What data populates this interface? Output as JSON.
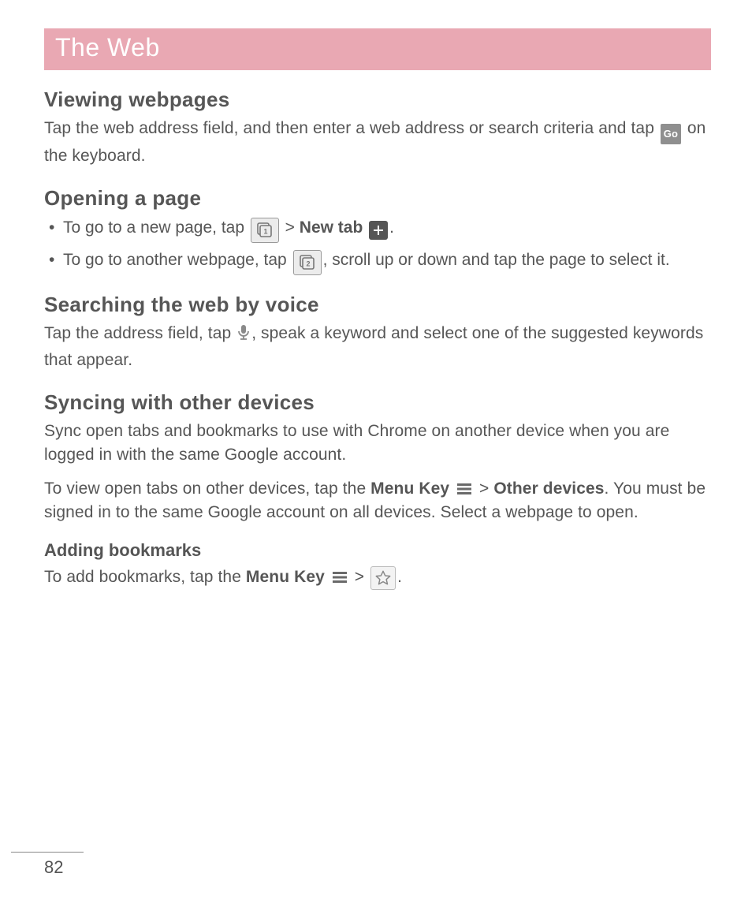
{
  "title": "The Web",
  "sections": {
    "viewing": {
      "heading": "Viewing webpages",
      "p1a": "Tap the web address field, and then enter a web address or search criteria and tap ",
      "go": "Go",
      "p1b": " on the keyboard."
    },
    "opening": {
      "heading": "Opening a page",
      "li1a": "To go to a new page, tap ",
      "gt1": " > ",
      "newtab": "New tab",
      "period1": ".",
      "li2a": "To go to another webpage, tap ",
      "li2b": ", scroll up or down and tap the page to select it."
    },
    "searching": {
      "heading": "Searching the web by voice",
      "p1a": "Tap the address field, tap ",
      "p1b": ", speak a keyword and select one of the suggested keywords that appear."
    },
    "syncing": {
      "heading": "Syncing with other devices",
      "p1": "Sync open tabs and bookmarks to use with Chrome on another device when you are logged in with the same Google account.",
      "p2a": "To view open tabs on other devices, tap the ",
      "menukey": "Menu Key",
      "gt": " > ",
      "other": "Other devices",
      "p2b": ". You must be signed in to the same Google account on all devices. Select a webpage to open."
    },
    "bookmarks": {
      "heading": "Adding bookmarks",
      "p1a": "To add bookmarks, tap the ",
      "menukey": "Menu Key",
      "gt": " > ",
      "period": "."
    }
  },
  "page_number": "82"
}
